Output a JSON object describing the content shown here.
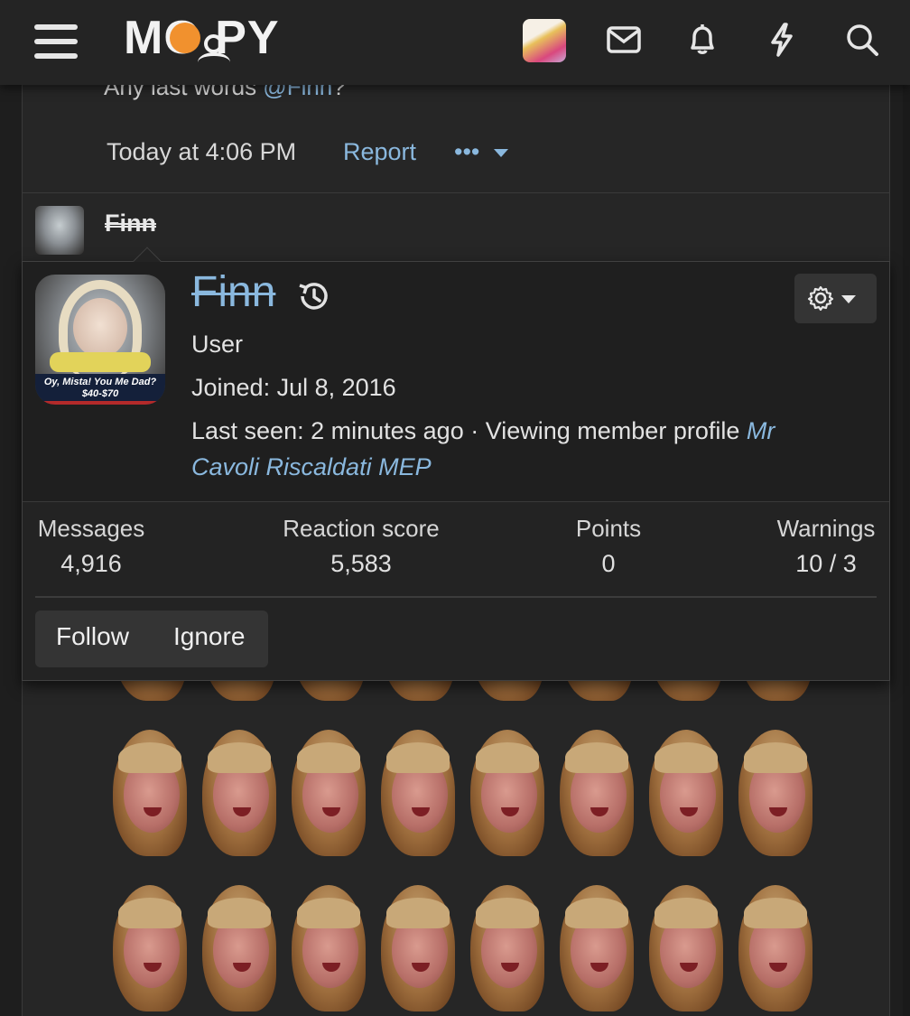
{
  "header": {
    "logo_text": "MO  PY",
    "icons": [
      "menu-icon",
      "envelope-icon",
      "bell-icon",
      "lightning-icon",
      "search-icon"
    ]
  },
  "previous_post": {
    "text_prefix": "Any last words ",
    "mention": "@Finn",
    "text_suffix": "?",
    "timestamp": "Today at 4:06 PM",
    "report_label": "Report",
    "more_label": "•••"
  },
  "post": {
    "username": "Finn"
  },
  "member_card": {
    "name": "Finn",
    "avatar_caption_line1": "Oy, Mista! You Me Dad?",
    "avatar_caption_line2": "$40-$70",
    "title": "User",
    "joined_label": "Joined:",
    "joined_date": "Jul 8, 2016",
    "last_seen_label": "Last seen:",
    "last_seen_value": "2 minutes ago",
    "activity_prefix": "· Viewing member profile",
    "activity_link_line1": "Mr",
    "activity_link_line2": "Cavoli Riscaldati MEP",
    "stats": [
      {
        "label": "Messages",
        "value": "4,916"
      },
      {
        "label": "Reaction score",
        "value": "5,583"
      },
      {
        "label": "Points",
        "value": "0"
      },
      {
        "label": "Warnings",
        "value": "10 / 3"
      }
    ],
    "follow_label": "Follow",
    "ignore_label": "Ignore"
  },
  "colors": {
    "background": "#1e1e1e",
    "panel": "#262626",
    "link": "#8ab8de",
    "logo_accent": "#f1912e"
  }
}
